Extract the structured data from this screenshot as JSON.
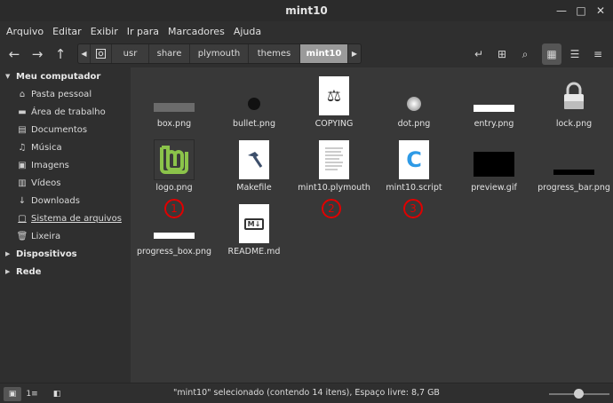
{
  "window": {
    "title": "mint10"
  },
  "menu": [
    "Arquivo",
    "Editar",
    "Exibir",
    "Ir para",
    "Marcadores",
    "Ajuda"
  ],
  "path": [
    "usr",
    "share",
    "plymouth",
    "themes",
    "mint10"
  ],
  "sidebar": {
    "computer_header": "Meu computador",
    "items": [
      {
        "label": "Pasta pessoal",
        "icon": "home-icon"
      },
      {
        "label": "Área de trabalho",
        "icon": "desktop-icon"
      },
      {
        "label": "Documentos",
        "icon": "documents-icon"
      },
      {
        "label": "Música",
        "icon": "music-icon"
      },
      {
        "label": "Imagens",
        "icon": "pictures-icon"
      },
      {
        "label": "Vídeos",
        "icon": "videos-icon"
      },
      {
        "label": "Downloads",
        "icon": "downloads-icon"
      },
      {
        "label": "Sistema de arquivos",
        "icon": "filesystem-icon"
      },
      {
        "label": "Lixeira",
        "icon": "trash-icon"
      }
    ],
    "devices_header": "Dispositivos",
    "network_header": "Rede"
  },
  "files": [
    {
      "name": "box.png"
    },
    {
      "name": "bullet.png"
    },
    {
      "name": "COPYING"
    },
    {
      "name": "dot.png"
    },
    {
      "name": "entry.png"
    },
    {
      "name": "lock.png"
    },
    {
      "name": "logo.png"
    },
    {
      "name": "Makefile"
    },
    {
      "name": "mint10.plymouth"
    },
    {
      "name": "mint10.script"
    },
    {
      "name": "preview.gif"
    },
    {
      "name": "progress_bar.png"
    },
    {
      "name": "progress_box.png"
    },
    {
      "name": "README.md"
    }
  ],
  "annotations": [
    "1",
    "2",
    "3"
  ],
  "status": "\"mint10\" selecionado (contendo 14 itens), Espaço livre: 8,7 GB",
  "colors": {
    "accent": "#8bc34a",
    "annotation": "#e00000",
    "script_blue": "#2e9ae6"
  }
}
